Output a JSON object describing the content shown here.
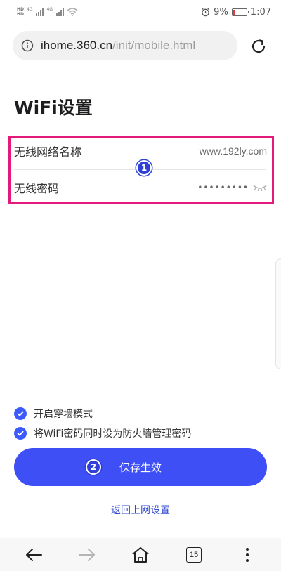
{
  "status_bar": {
    "battery_percent_text": "9%",
    "time": "1:07",
    "battery_level": 0.09,
    "network_tags": [
      "4G",
      "4G"
    ]
  },
  "address_bar": {
    "url_host": "ihome.360.cn",
    "url_path": "/init/mobile.html"
  },
  "page": {
    "title": "WiFi设置"
  },
  "wifi_form": {
    "ssid_label": "无线网络名称",
    "ssid_value": "www.192ly.com",
    "password_label": "无线密码",
    "password_masked": "•••••••••"
  },
  "options": [
    {
      "label": "开启穿墙模式",
      "checked": true
    },
    {
      "label": "将WiFi密码同时设为防火墙管理密码",
      "checked": true
    }
  ],
  "save_button": {
    "label": "保存生效"
  },
  "back_link": {
    "label": "返回上网设置"
  },
  "markers": {
    "first": "1",
    "second": "2"
  },
  "bottom_nav": {
    "tabs_count": "15"
  },
  "colors": {
    "accent": "#3d4ff5",
    "highlight_border": "#e4197a",
    "marker": "#2f3fd7",
    "link": "#2f49d1"
  },
  "icons": {
    "info": "info-icon",
    "reload": "reload-icon",
    "eye": "eye-closed-icon",
    "back": "back-arrow-icon",
    "forward": "forward-arrow-icon",
    "home": "home-icon",
    "tabs": "tabs-icon",
    "menu": "more-vertical-icon"
  }
}
